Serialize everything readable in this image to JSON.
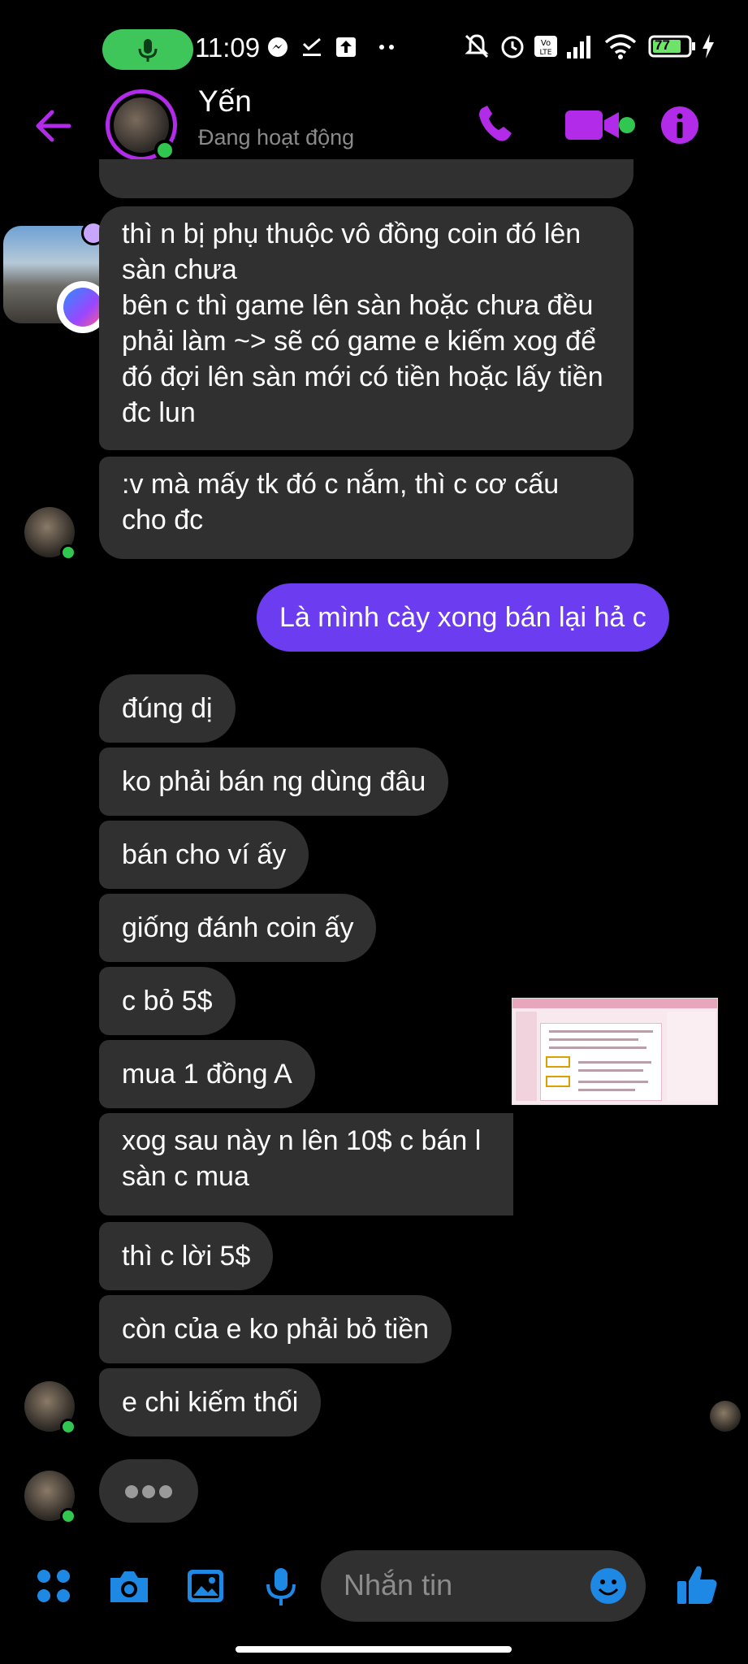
{
  "status_bar": {
    "time": "11:09",
    "battery": "77"
  },
  "header": {
    "name": "Yến",
    "status": "Đang hoạt động"
  },
  "messages": [
    {
      "id": "m1",
      "text": "thì n bị phụ thuộc vô đồng coin đó lên sàn chưa\nbên c thì game lên sàn hoặc chưa đều phải làm ~> sẽ có game e kiếm xog để đó đợi lên sàn mới có tiền hoặc lấy tiền đc lun"
    },
    {
      "id": "m2",
      "text": ":v mà mấy tk đó c nắm, thì c cơ cấu cho đc"
    },
    {
      "id": "m3",
      "text": "Là mình cày xong bán lại hả c"
    },
    {
      "id": "m4",
      "text": "đúng dị"
    },
    {
      "id": "m5",
      "text": "ko phải bán ng dùng đâu"
    },
    {
      "id": "m6",
      "text": "bán cho ví ấy"
    },
    {
      "id": "m7",
      "text": "giống đánh coin ấy"
    },
    {
      "id": "m8",
      "text": "c bỏ 5$"
    },
    {
      "id": "m9",
      "text": "mua 1 đồng A"
    },
    {
      "id": "m10",
      "text": "xog sau này n lên 10$ c bán l\nsàn c mua"
    },
    {
      "id": "m11",
      "text": "thì c lời 5$"
    },
    {
      "id": "m12",
      "text": "còn của e ko phải bỏ tiền"
    },
    {
      "id": "m13",
      "text": "e chi kiếm thối"
    }
  ],
  "composer": {
    "placeholder": "Nhắn tin"
  },
  "colors": {
    "accent": "#b22be8",
    "sent_bubble": "#6c3cf0",
    "received_bubble": "#303030",
    "online": "#31c650",
    "composer_icons": "#1e88e5"
  }
}
